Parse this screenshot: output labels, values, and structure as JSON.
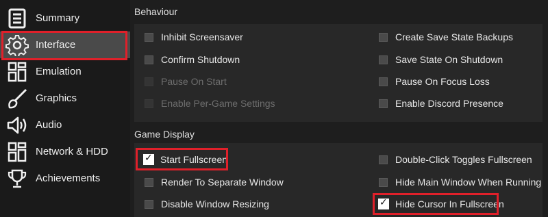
{
  "sidebar": {
    "items": [
      {
        "label": "Summary",
        "icon": "summary-icon"
      },
      {
        "label": "Interface",
        "icon": "gear-icon"
      },
      {
        "label": "Emulation",
        "icon": "grid-icon"
      },
      {
        "label": "Graphics",
        "icon": "brush-icon"
      },
      {
        "label": "Audio",
        "icon": "speaker-icon"
      },
      {
        "label": "Network & HDD",
        "icon": "network-icon"
      },
      {
        "label": "Achievements",
        "icon": "trophy-icon"
      }
    ],
    "selected": "Interface"
  },
  "behaviour": {
    "title": "Behaviour",
    "left": [
      {
        "label": "Inhibit Screensaver",
        "checked": false,
        "enabled": true
      },
      {
        "label": "Confirm Shutdown",
        "checked": false,
        "enabled": true
      },
      {
        "label": "Pause On Start",
        "checked": false,
        "enabled": false
      },
      {
        "label": "Enable Per-Game Settings",
        "checked": false,
        "enabled": false
      }
    ],
    "right": [
      {
        "label": "Create Save State Backups",
        "checked": false,
        "enabled": true
      },
      {
        "label": "Save State On Shutdown",
        "checked": false,
        "enabled": true
      },
      {
        "label": "Pause On Focus Loss",
        "checked": false,
        "enabled": true
      },
      {
        "label": "Enable Discord Presence",
        "checked": false,
        "enabled": true
      }
    ]
  },
  "game_display": {
    "title": "Game Display",
    "left": [
      {
        "label": "Start Fullscreen",
        "checked": true,
        "enabled": true
      },
      {
        "label": "Render To Separate Window",
        "checked": false,
        "enabled": true
      },
      {
        "label": "Disable Window Resizing",
        "checked": false,
        "enabled": true
      }
    ],
    "right": [
      {
        "label": "Double-Click Toggles Fullscreen",
        "checked": false,
        "enabled": true
      },
      {
        "label": "Hide Main Window When Running",
        "checked": false,
        "enabled": true
      },
      {
        "label": "Hide Cursor In Fullscreen",
        "checked": true,
        "enabled": true
      }
    ]
  },
  "colors": {
    "highlight": "#e0202a",
    "selected_bg": "#4a4a4a"
  }
}
